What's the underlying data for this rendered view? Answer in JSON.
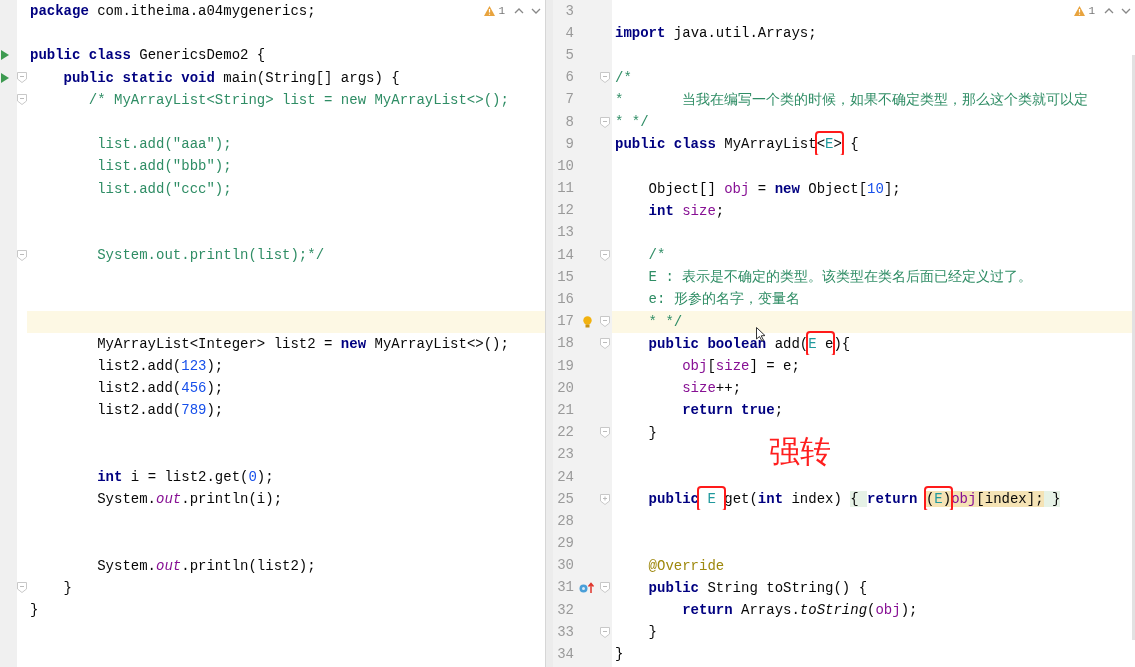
{
  "left_editor": {
    "warnings": "1",
    "lines": [
      {
        "current": false,
        "tokens": [
          {
            "kind": "kw",
            "text": "package"
          },
          {
            "kind": "plain",
            "text": " com.itheima.a04mygenerics;"
          }
        ]
      },
      {
        "current": false
      },
      {
        "current": false,
        "gutter": [
          {
            "kind": "run"
          }
        ],
        "tokens": [
          {
            "kind": "kw",
            "text": "public class"
          },
          {
            "kind": "plain",
            "text": " GenericsDemo2 {"
          }
        ]
      },
      {
        "current": false,
        "gutter": [
          {
            "kind": "run"
          },
          {
            "kind": "fold"
          }
        ],
        "tokens": [
          {
            "kind": "kw",
            "text": "    public static void"
          },
          {
            "kind": "plain",
            "text": " main(String[] args) {"
          }
        ]
      },
      {
        "current": false,
        "gutter": [
          {
            "kind": "fold"
          }
        ],
        "tokens": [
          {
            "kind": "comment",
            "text": "       /* MyArrayList<String> list = new MyArrayList<>();"
          }
        ]
      },
      {
        "current": false
      },
      {
        "current": false,
        "tokens": [
          {
            "kind": "comment",
            "text": "        list.add(\"aaa\");"
          }
        ]
      },
      {
        "current": false,
        "tokens": [
          {
            "kind": "comment",
            "text": "        list.add(\"bbb\");"
          }
        ]
      },
      {
        "current": false,
        "tokens": [
          {
            "kind": "comment",
            "text": "        list.add(\"ccc\");"
          }
        ]
      },
      {
        "current": false
      },
      {
        "current": false
      },
      {
        "current": false,
        "gutter": [
          {
            "kind": "fold"
          }
        ],
        "tokens": [
          {
            "kind": "comment",
            "text": "        System.out.println(list);*/"
          }
        ]
      },
      {
        "current": false
      },
      {
        "current": false
      },
      {
        "current": true
      },
      {
        "current": false,
        "tokens": [
          {
            "kind": "plain",
            "text": "        MyArrayList<Integer> list2 = "
          },
          {
            "kind": "kw",
            "text": "new"
          },
          {
            "kind": "plain",
            "text": " MyArrayList<>();"
          }
        ]
      },
      {
        "current": false,
        "tokens": [
          {
            "kind": "plain",
            "text": "        list2.add("
          },
          {
            "kind": "num",
            "text": "123"
          },
          {
            "kind": "plain",
            "text": ");"
          }
        ]
      },
      {
        "current": false,
        "tokens": [
          {
            "kind": "plain",
            "text": "        list2.add("
          },
          {
            "kind": "num",
            "text": "456"
          },
          {
            "kind": "plain",
            "text": ");"
          }
        ]
      },
      {
        "current": false,
        "tokens": [
          {
            "kind": "plain",
            "text": "        list2.add("
          },
          {
            "kind": "num",
            "text": "789"
          },
          {
            "kind": "plain",
            "text": ");"
          }
        ]
      },
      {
        "current": false
      },
      {
        "current": false
      },
      {
        "current": false,
        "tokens": [
          {
            "kind": "kw",
            "text": "        int"
          },
          {
            "kind": "plain",
            "text": " i = list2.get("
          },
          {
            "kind": "num",
            "text": "0"
          },
          {
            "kind": "plain",
            "text": ");"
          }
        ]
      },
      {
        "current": false,
        "tokens": [
          {
            "kind": "plain",
            "text": "        System."
          },
          {
            "kind": "static",
            "text": "out"
          },
          {
            "kind": "plain",
            "text": ".println(i);"
          }
        ]
      },
      {
        "current": false
      },
      {
        "current": false
      },
      {
        "current": false,
        "tokens": [
          {
            "kind": "plain",
            "text": "        System."
          },
          {
            "kind": "static",
            "text": "out"
          },
          {
            "kind": "plain",
            "text": ".println(list2);"
          }
        ]
      },
      {
        "current": false,
        "gutter": [
          {
            "kind": "fold"
          }
        ],
        "tokens": [
          {
            "kind": "plain",
            "text": "    }"
          }
        ]
      },
      {
        "current": false,
        "tokens": [
          {
            "kind": "plain",
            "text": "}"
          }
        ]
      }
    ]
  },
  "right_editor": {
    "warnings": "1",
    "overlay_text": "强转",
    "lines": [
      {
        "number": "3",
        "current": false
      },
      {
        "number": "4",
        "current": false,
        "tokens": [
          {
            "kind": "kw",
            "text": "import"
          },
          {
            "kind": "plain",
            "text": " java.util.Arrays;"
          }
        ]
      },
      {
        "number": "5",
        "current": false
      },
      {
        "number": "6",
        "current": false,
        "gutter": [
          {
            "kind": "fold"
          }
        ],
        "tokens": [
          {
            "kind": "comment",
            "text": "/*"
          }
        ]
      },
      {
        "number": "7",
        "current": false,
        "tokens": [
          {
            "kind": "comment",
            "text": "*       当我在编写一个类的时候，如果不确定类型，那么这个类就可以定"
          }
        ]
      },
      {
        "number": "8",
        "current": false,
        "gutter": [
          {
            "kind": "fold"
          }
        ],
        "tokens": [
          {
            "kind": "comment",
            "text": "* */"
          }
        ]
      },
      {
        "number": "9",
        "current": false,
        "tokens": [
          {
            "kind": "kw",
            "text": "public class"
          },
          {
            "kind": "plain",
            "text": " MyArrayList"
          },
          {
            "kind": "boxed",
            "tokens": [
              {
                "kind": "plain",
                "text": "<"
              },
              {
                "kind": "type",
                "text": "E"
              },
              {
                "kind": "plain",
                "text": ">"
              }
            ]
          },
          {
            "kind": "plain",
            "text": " {"
          }
        ]
      },
      {
        "number": "10",
        "current": false
      },
      {
        "number": "11",
        "current": false,
        "tokens": [
          {
            "kind": "plain",
            "text": "    Object[] "
          },
          {
            "kind": "field",
            "text": "obj"
          },
          {
            "kind": "plain",
            "text": " = "
          },
          {
            "kind": "kw",
            "text": "new"
          },
          {
            "kind": "plain",
            "text": " Object["
          },
          {
            "kind": "num",
            "text": "10"
          },
          {
            "kind": "plain",
            "text": "];"
          }
        ]
      },
      {
        "number": "12",
        "current": false,
        "tokens": [
          {
            "kind": "kw",
            "text": "    int"
          },
          {
            "kind": "field",
            "text": " size"
          },
          {
            "kind": "plain",
            "text": ";"
          }
        ]
      },
      {
        "number": "13",
        "current": false
      },
      {
        "number": "14",
        "current": false,
        "gutter": [
          {
            "kind": "fold"
          }
        ],
        "tokens": [
          {
            "kind": "comment",
            "text": "    /*"
          }
        ]
      },
      {
        "number": "15",
        "current": false,
        "tokens": [
          {
            "kind": "comment",
            "text": "    E : 表示是不确定的类型。该类型在类名后面已经定义过了。"
          }
        ]
      },
      {
        "number": "16",
        "current": false,
        "tokens": [
          {
            "kind": "comment",
            "text": "    e: 形参的名字，变量名"
          }
        ]
      },
      {
        "number": "17",
        "current": true,
        "gutter": [
          {
            "kind": "bulb"
          },
          {
            "kind": "fold"
          }
        ],
        "tokens": [
          {
            "kind": "comment",
            "text": "    * */"
          }
        ]
      },
      {
        "number": "18",
        "current": false,
        "gutter": [
          {
            "kind": "fold"
          }
        ],
        "tokens": [
          {
            "kind": "kw",
            "text": "    public boolean"
          },
          {
            "kind": "plain",
            "text": " add("
          },
          {
            "kind": "boxed",
            "tokens": [
              {
                "kind": "type",
                "text": "E"
              },
              {
                "kind": "plain",
                "text": " e"
              }
            ]
          },
          {
            "kind": "plain",
            "text": "){"
          }
        ]
      },
      {
        "number": "19",
        "current": false,
        "tokens": [
          {
            "kind": "field",
            "text": "        obj"
          },
          {
            "kind": "plain",
            "text": "["
          },
          {
            "kind": "field",
            "text": "size"
          },
          {
            "kind": "plain",
            "text": "] = e;"
          }
        ]
      },
      {
        "number": "20",
        "current": false,
        "tokens": [
          {
            "kind": "field",
            "text": "        size"
          },
          {
            "kind": "plain",
            "text": "++;"
          }
        ]
      },
      {
        "number": "21",
        "current": false,
        "tokens": [
          {
            "kind": "kw",
            "text": "        return true"
          },
          {
            "kind": "plain",
            "text": ";"
          }
        ]
      },
      {
        "number": "22",
        "current": false,
        "gutter": [
          {
            "kind": "fold"
          }
        ],
        "tokens": [
          {
            "kind": "plain",
            "text": "    }"
          }
        ]
      },
      {
        "number": "23",
        "current": false
      },
      {
        "number": "24",
        "current": false
      },
      {
        "number": "25",
        "current": false,
        "gutter": [
          {
            "kind": "collapsed"
          }
        ],
        "tokens": [
          {
            "kind": "kw",
            "text": "    public"
          },
          {
            "kind": "boxed",
            "tokens": [
              {
                "kind": "type",
                "text": " E "
              }
            ]
          },
          {
            "kind": "plain",
            "text": "get("
          },
          {
            "kind": "kw",
            "text": "int"
          },
          {
            "kind": "plain",
            "text": " index) "
          },
          {
            "kind": "fold",
            "text": "{ "
          },
          {
            "kind": "kw",
            "text": "return "
          },
          {
            "kind": "boxed",
            "tokens": [
              {
                "kind": "hl",
                "text": "("
              },
              {
                "kind": "hl-type",
                "text": "E"
              },
              {
                "kind": "hl",
                "text": ")"
              }
            ]
          },
          {
            "kind": "hl-field",
            "text": "obj"
          },
          {
            "kind": "hl",
            "text": "[index];"
          },
          {
            "kind": "fold",
            "text": " }"
          }
        ]
      },
      {
        "number": "28",
        "current": false
      },
      {
        "number": "29",
        "current": false
      },
      {
        "number": "30",
        "current": false,
        "tokens": [
          {
            "kind": "annot",
            "text": "    @Override"
          }
        ]
      },
      {
        "number": "31",
        "current": false,
        "gutter": [
          {
            "kind": "override"
          },
          {
            "kind": "fold"
          }
        ],
        "tokens": [
          {
            "kind": "kw",
            "text": "    public"
          },
          {
            "kind": "plain",
            "text": " String toString() {"
          }
        ]
      },
      {
        "number": "32",
        "current": false,
        "tokens": [
          {
            "kind": "kw",
            "text": "        return"
          },
          {
            "kind": "plain",
            "text": " Arrays."
          },
          {
            "kind": "italic",
            "text": "toString"
          },
          {
            "kind": "plain",
            "text": "("
          },
          {
            "kind": "field",
            "text": "obj"
          },
          {
            "kind": "plain",
            "text": ");"
          }
        ]
      },
      {
        "number": "33",
        "current": false,
        "gutter": [
          {
            "kind": "fold"
          }
        ],
        "tokens": [
          {
            "kind": "plain",
            "text": "    }"
          }
        ]
      },
      {
        "number": "34",
        "current": false,
        "tokens": [
          {
            "kind": "plain",
            "text": "}"
          }
        ]
      }
    ]
  }
}
